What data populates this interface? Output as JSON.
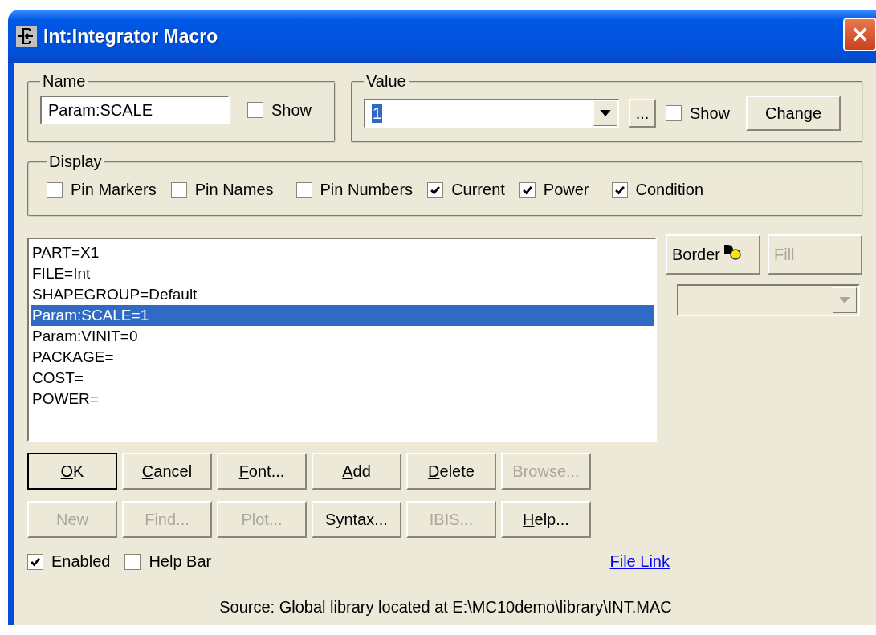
{
  "window": {
    "title": "Int:Integrator Macro"
  },
  "name_group": {
    "label": "Name",
    "value": "Param:SCALE",
    "show": {
      "label": "Show",
      "checked": false
    }
  },
  "value_group": {
    "label": "Value",
    "value": "1",
    "browse_label": "...",
    "show": {
      "label": "Show",
      "checked": false
    },
    "change_label": "Change"
  },
  "display_group": {
    "label": "Display",
    "options": [
      {
        "label": "Pin Markers",
        "checked": false
      },
      {
        "label": "Pin Names",
        "checked": false
      },
      {
        "label": "Pin Numbers",
        "checked": false
      },
      {
        "label": "Current",
        "checked": true
      },
      {
        "label": "Power",
        "checked": true
      },
      {
        "label": "Condition",
        "checked": true
      }
    ]
  },
  "attributes": [
    {
      "text": "PART=X1",
      "selected": false
    },
    {
      "text": "FILE=Int",
      "selected": false
    },
    {
      "text": "SHAPEGROUP=Default",
      "selected": false
    },
    {
      "text": "Param:SCALE=1",
      "selected": true
    },
    {
      "text": "Param:VINIT=0",
      "selected": false
    },
    {
      "text": "PACKAGE=",
      "selected": false
    },
    {
      "text": "COST=",
      "selected": false
    },
    {
      "text": "POWER=",
      "selected": false
    }
  ],
  "side_buttons": [
    {
      "label": "Border",
      "disabled": false
    },
    {
      "label": "Fill",
      "disabled": true
    }
  ],
  "side_combo": {
    "disabled": true
  },
  "button_rows": [
    [
      {
        "label": "OK",
        "mnemonic": true,
        "disabled": false,
        "default": true
      },
      {
        "label": "Cancel",
        "mnemonic": true,
        "disabled": false,
        "default": false
      },
      {
        "label": "Font...",
        "mnemonic": true,
        "disabled": false,
        "default": false
      },
      {
        "label": "Add",
        "mnemonic": true,
        "disabled": false,
        "default": false
      },
      {
        "label": "Delete",
        "mnemonic": true,
        "disabled": false,
        "default": false
      },
      {
        "label": "Browse...",
        "mnemonic": false,
        "disabled": true,
        "default": false
      }
    ],
    [
      {
        "label": "New",
        "mnemonic": false,
        "disabled": true,
        "default": false
      },
      {
        "label": "Find...",
        "mnemonic": false,
        "disabled": true,
        "default": false
      },
      {
        "label": "Plot...",
        "mnemonic": false,
        "disabled": true,
        "default": false
      },
      {
        "label": "Syntax...",
        "mnemonic": false,
        "disabled": false,
        "default": false
      },
      {
        "label": "IBIS...",
        "mnemonic": false,
        "disabled": true,
        "default": false
      },
      {
        "label": "Help...",
        "mnemonic": true,
        "disabled": false,
        "default": false
      }
    ]
  ],
  "bottom_options": [
    {
      "label": "Enabled",
      "checked": true
    },
    {
      "label": "Help Bar",
      "checked": false
    }
  ],
  "file_link": "File Link",
  "source": "Source: Global library located at E:\\MC10demo\\library\\INT.MAC"
}
